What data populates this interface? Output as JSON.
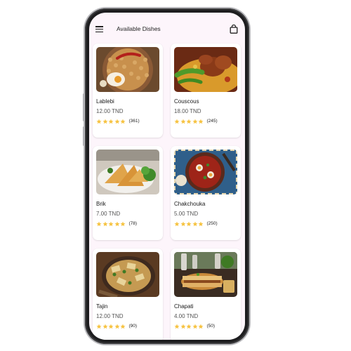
{
  "appbar": {
    "title": "Available Dishes",
    "menu_icon": "hamburger-menu-icon",
    "cart_icon": "shopping-bag-icon"
  },
  "colors": {
    "screen_background": "#fdf5fb",
    "star": "#f6c342",
    "card": "#ffffff"
  },
  "dishes": [
    {
      "name": "Lablebi",
      "price": "12.00 TND",
      "rating": 5,
      "reviews": "(361)"
    },
    {
      "name": "Couscous",
      "price": "18.00 TND",
      "rating": 5,
      "reviews": "(245)"
    },
    {
      "name": "Brik",
      "price": "7.00 TND",
      "rating": 5,
      "reviews": "(78)"
    },
    {
      "name": "Chakchouka",
      "price": "5.00 TND",
      "rating": 5,
      "reviews": "(250)"
    },
    {
      "name": "Tajin",
      "price": "12.00 TND",
      "rating": 5,
      "reviews": "(90)"
    },
    {
      "name": "Chapati",
      "price": "4.00 TND",
      "rating": 5,
      "reviews": "(50)"
    }
  ]
}
